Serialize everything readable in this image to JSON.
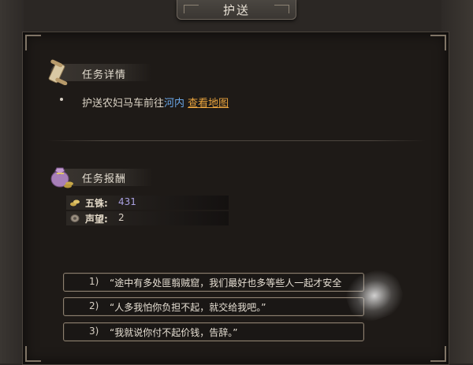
{
  "window": {
    "title": "护送"
  },
  "task_details": {
    "header": "任务详情",
    "description_prefix": "护送农妇马车前往",
    "destination": "河内",
    "map_link": "查看地图"
  },
  "rewards": {
    "header": "任务报酬",
    "items": [
      {
        "label": "五铢:",
        "value": "431",
        "icon": "coin-icon"
      },
      {
        "label": "声望:",
        "value": "2",
        "icon": "reputation-icon"
      }
    ]
  },
  "dialogue_options": [
    {
      "number": "1)",
      "text": "“途中有多处匪翦贼窟，我们最好也多等些人一起才安全"
    },
    {
      "number": "2)",
      "text": "“人多我怕你负担不起，就交给我吧。”"
    },
    {
      "number": "3)",
      "text": "“我就说你付不起价钱，告辞。”"
    }
  ],
  "colors": {
    "link_place": "#6aa7e8",
    "link_map": "#e8a33d",
    "panel_bg": "#1e1a17"
  }
}
